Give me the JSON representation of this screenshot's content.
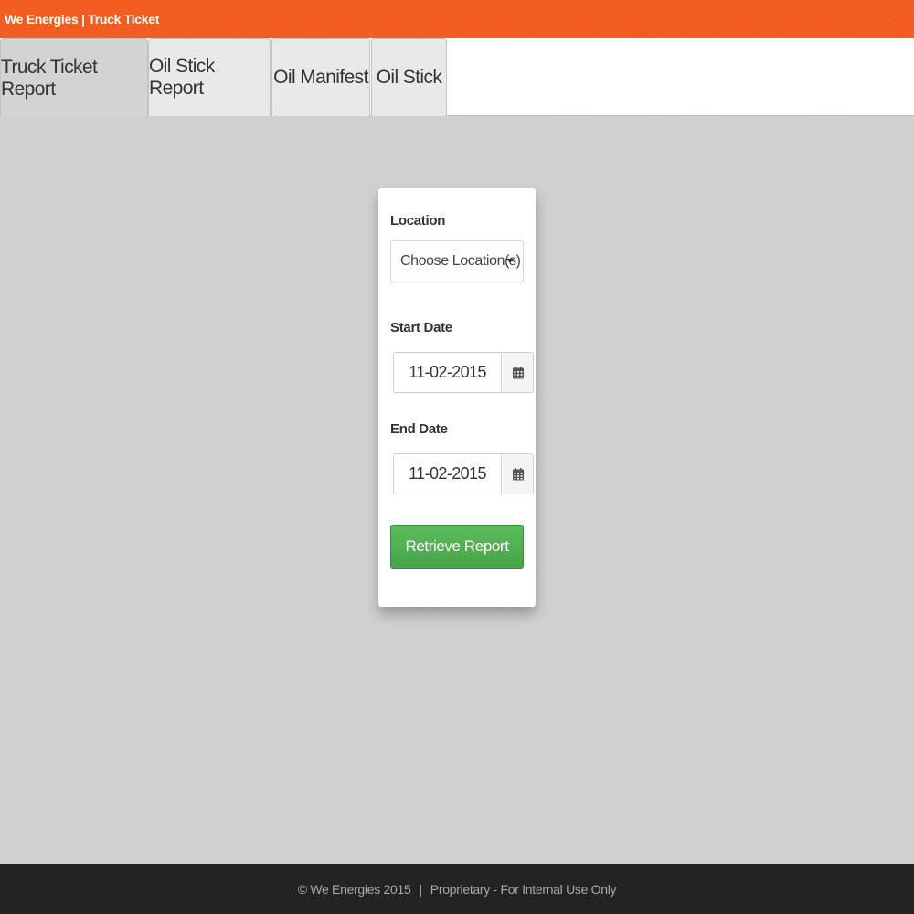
{
  "header": {
    "title": "We Energies | Truck Ticket"
  },
  "tabs": [
    {
      "label": "Truck Ticket Report",
      "active": true
    },
    {
      "label": "Oil Stick Report",
      "active": false
    },
    {
      "label": "Oil Manifest",
      "active": false
    },
    {
      "label": "Oil Stick",
      "active": false
    }
  ],
  "form": {
    "location_label": "Location",
    "location_value": "Choose Location(s)",
    "start_date_label": "Start Date",
    "start_date_value": "11-02-2015",
    "end_date_label": "End Date",
    "end_date_value": "11-02-2015",
    "submit_label": "Retrieve Report"
  },
  "footer": {
    "copyright": "© We Energies 2015",
    "separator": "|",
    "notice": "Proprietary - For Internal Use Only"
  },
  "colors": {
    "brand": "#f15a1b",
    "button": "#47a447",
    "background": "#cfcfcf",
    "footer": "#232323"
  },
  "icons": [
    "calendar-icon",
    "chevron-down-icon"
  ]
}
